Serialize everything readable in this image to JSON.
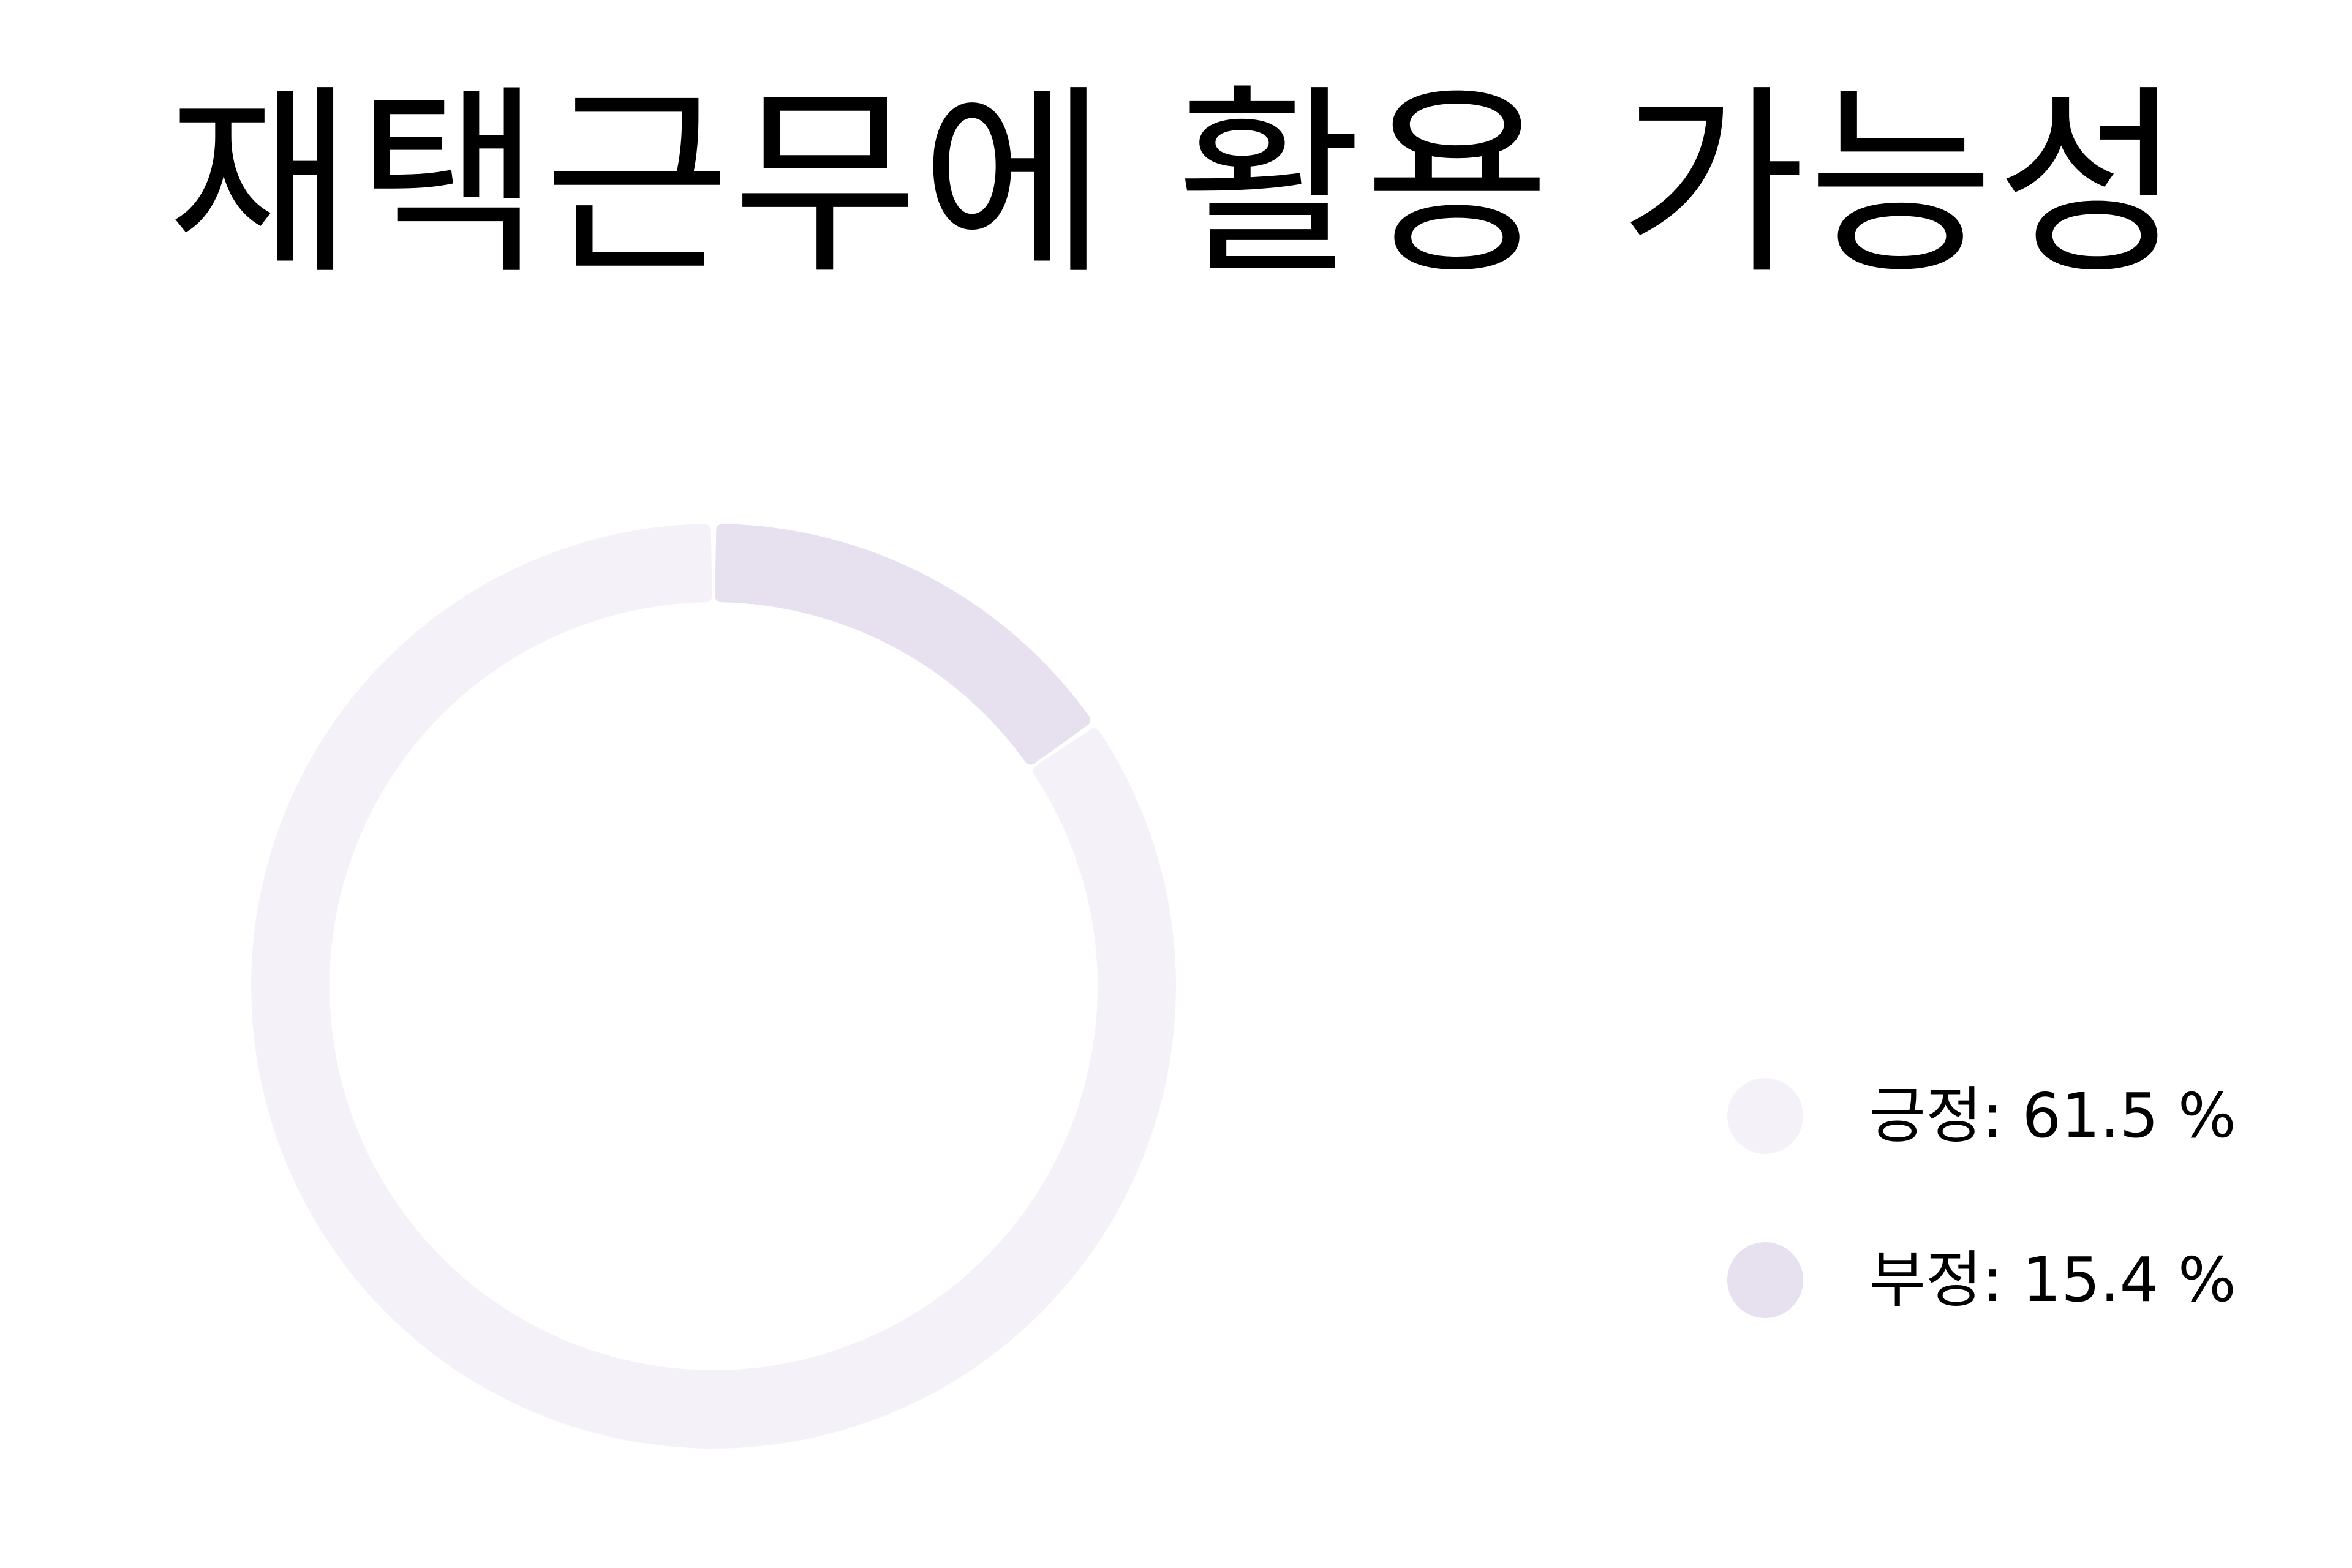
{
  "title": "재택근무에 활용 가능성",
  "chart_data": {
    "type": "pie",
    "title": "재택근무에 활용 가능성",
    "donut": true,
    "total": 100,
    "slices": [
      {
        "label": "긍정",
        "value": 61.5,
        "display": "긍정: 61.5 %",
        "color": "#f4f2f8"
      },
      {
        "label": "부정",
        "value": 15.4,
        "display": "부정: 15.4 %",
        "color": "#e6e0ef"
      }
    ],
    "legend_position": "right"
  }
}
